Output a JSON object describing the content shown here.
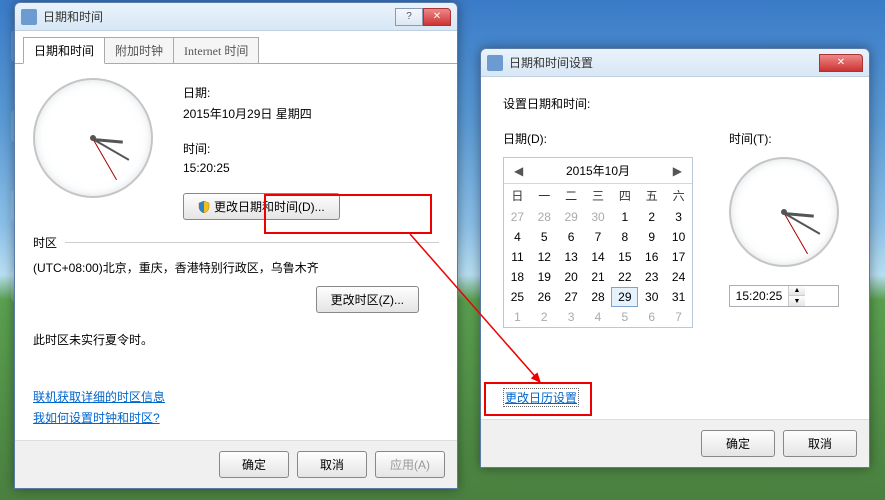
{
  "desktop_icons": [
    "",
    "",
    "",
    ""
  ],
  "win1": {
    "title": "日期和时间",
    "tabs": [
      "日期和时间",
      "附加时钟",
      "Internet 时间"
    ],
    "date_label": "日期:",
    "date_value": "2015年10月29日 星期四",
    "time_label": "时间:",
    "time_value": "15:20:25",
    "change_dt_btn": "更改日期和时间(D)...",
    "tz_heading": "时区",
    "tz_value": "(UTC+08:00)北京，重庆，香港特别行政区，乌鲁木齐",
    "change_tz_btn": "更改时区(Z)...",
    "dst_note": "此时区未实行夏令时。",
    "link1": "联机获取详细的时区信息",
    "link2": "我如何设置时钟和时区?",
    "ok": "确定",
    "cancel": "取消",
    "apply": "应用(A)"
  },
  "win2": {
    "title": "日期和时间设置",
    "heading": "设置日期和时间:",
    "date_label": "日期(D):",
    "time_label": "时间(T):",
    "month_title": "2015年10月",
    "dow": [
      "日",
      "一",
      "二",
      "三",
      "四",
      "五",
      "六"
    ],
    "weeks": [
      [
        {
          "n": 27,
          "o": 1
        },
        {
          "n": 28,
          "o": 1
        },
        {
          "n": 29,
          "o": 1
        },
        {
          "n": 30,
          "o": 1
        },
        {
          "n": 1
        },
        {
          "n": 2
        },
        {
          "n": 3
        }
      ],
      [
        {
          "n": 4
        },
        {
          "n": 5
        },
        {
          "n": 6
        },
        {
          "n": 7
        },
        {
          "n": 8
        },
        {
          "n": 9
        },
        {
          "n": 10
        }
      ],
      [
        {
          "n": 11
        },
        {
          "n": 12
        },
        {
          "n": 13
        },
        {
          "n": 14
        },
        {
          "n": 15
        },
        {
          "n": 16
        },
        {
          "n": 17
        }
      ],
      [
        {
          "n": 18
        },
        {
          "n": 19
        },
        {
          "n": 20
        },
        {
          "n": 21
        },
        {
          "n": 22
        },
        {
          "n": 23
        },
        {
          "n": 24
        }
      ],
      [
        {
          "n": 25
        },
        {
          "n": 26
        },
        {
          "n": 27
        },
        {
          "n": 28
        },
        {
          "n": 29,
          "s": 1
        },
        {
          "n": 30
        },
        {
          "n": 31
        }
      ],
      [
        {
          "n": 1,
          "o": 1
        },
        {
          "n": 2,
          "o": 1
        },
        {
          "n": 3,
          "o": 1
        },
        {
          "n": 4,
          "o": 1
        },
        {
          "n": 5,
          "o": 1
        },
        {
          "n": 6,
          "o": 1
        },
        {
          "n": 7,
          "o": 1
        }
      ]
    ],
    "time_value": "15:20:25",
    "cal_settings_link": "更改日历设置",
    "ok": "确定",
    "cancel": "取消"
  }
}
